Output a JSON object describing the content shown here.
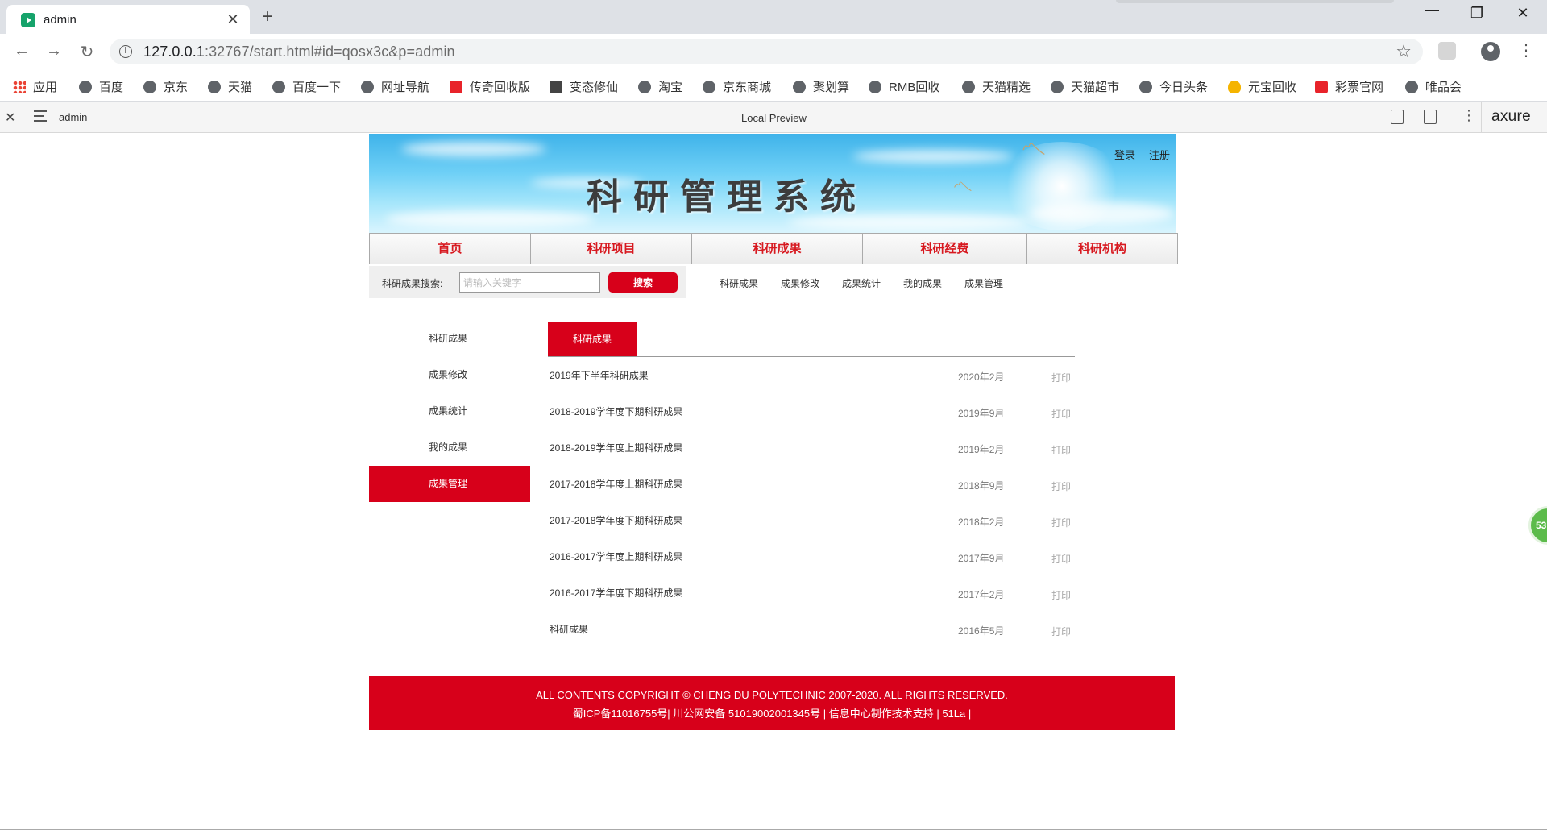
{
  "browser": {
    "tab_title": "admin",
    "tab_close": "✕",
    "new_tab": "+",
    "url_host": "127.0.0.1",
    "url_rest": ":32767/start.html#id=qosx3c&p=admin",
    "window_minimize": "—",
    "window_maximize": "❐",
    "window_close": "✕"
  },
  "bookmarks": [
    {
      "label": "应用",
      "icon": "apps-grid-icon"
    },
    {
      "label": "百度",
      "icon": "globe-icon"
    },
    {
      "label": "京东",
      "icon": "globe-icon"
    },
    {
      "label": "天猫",
      "icon": "globe-icon"
    },
    {
      "label": "百度一下",
      "icon": "globe-icon"
    },
    {
      "label": "网址导航",
      "icon": "globe-icon"
    },
    {
      "label": "传奇回收版",
      "icon": "red-app-icon"
    },
    {
      "label": "变态修仙",
      "icon": "game-icon"
    },
    {
      "label": "淘宝",
      "icon": "globe-icon"
    },
    {
      "label": "京东商城",
      "icon": "globe-icon"
    },
    {
      "label": "聚划算",
      "icon": "globe-icon"
    },
    {
      "label": "RMB回收",
      "icon": "globe-icon"
    },
    {
      "label": "天猫精选",
      "icon": "globe-icon"
    },
    {
      "label": "天猫超市",
      "icon": "globe-icon"
    },
    {
      "label": "今日头条",
      "icon": "globe-icon"
    },
    {
      "label": "元宝回收",
      "icon": "ingot-icon"
    },
    {
      "label": "彩票官网",
      "icon": "lottery-icon"
    },
    {
      "label": "唯品会",
      "icon": "globe-icon"
    }
  ],
  "axure": {
    "page_name": "admin",
    "center_label": "Local Preview",
    "logo": "axure"
  },
  "header": {
    "banner_title": "科研管理系统",
    "login": "登录",
    "register": "注册"
  },
  "main_nav": [
    {
      "label": "首页"
    },
    {
      "label": "科研项目"
    },
    {
      "label": "科研成果"
    },
    {
      "label": "科研经费"
    },
    {
      "label": "科研机构"
    }
  ],
  "search": {
    "label": "科研成果搜索:",
    "placeholder": "请输入关键字",
    "button": "搜索"
  },
  "sub_nav": [
    {
      "label": "科研成果"
    },
    {
      "label": "成果修改"
    },
    {
      "label": "成果统计"
    },
    {
      "label": "我的成果"
    },
    {
      "label": "成果管理"
    }
  ],
  "sidebar": [
    {
      "label": "科研成果",
      "active": false
    },
    {
      "label": "成果修改",
      "active": false
    },
    {
      "label": "成果统计",
      "active": false
    },
    {
      "label": "我的成果",
      "active": false
    },
    {
      "label": "成果管理",
      "active": true
    }
  ],
  "list": {
    "tab": "科研成果",
    "rows": [
      {
        "title": "2019年下半年科研成果",
        "date": "2020年2月",
        "action": "打印"
      },
      {
        "title": "2018-2019学年度下期科研成果",
        "date": "2019年9月",
        "action": "打印"
      },
      {
        "title": "2018-2019学年度上期科研成果",
        "date": "2019年2月",
        "action": "打印"
      },
      {
        "title": "2017-2018学年度上期科研成果",
        "date": "2018年9月",
        "action": "打印"
      },
      {
        "title": "2017-2018学年度下期科研成果",
        "date": "2018年2月",
        "action": "打印"
      },
      {
        "title": "2016-2017学年度上期科研成果",
        "date": "2017年9月",
        "action": "打印"
      },
      {
        "title": "2016-2017学年度下期科研成果",
        "date": "2017年2月",
        "action": "打印"
      },
      {
        "title": "科研成果",
        "date": "2016年5月",
        "action": "打印"
      }
    ]
  },
  "footer": {
    "line1": "ALL CONTENTS COPYRIGHT © CHENG DU POLYTECHNIC 2007-2020. ALL RIGHTS RESERVED.",
    "line2": "蜀ICP备11016755号| 川公网安备 51019002001345号   |   信息中心制作技术支持   |   51La |"
  },
  "float_badge": "53",
  "colors": {
    "brand_red": "#d7001a",
    "nav_text_red": "#d71920"
  }
}
